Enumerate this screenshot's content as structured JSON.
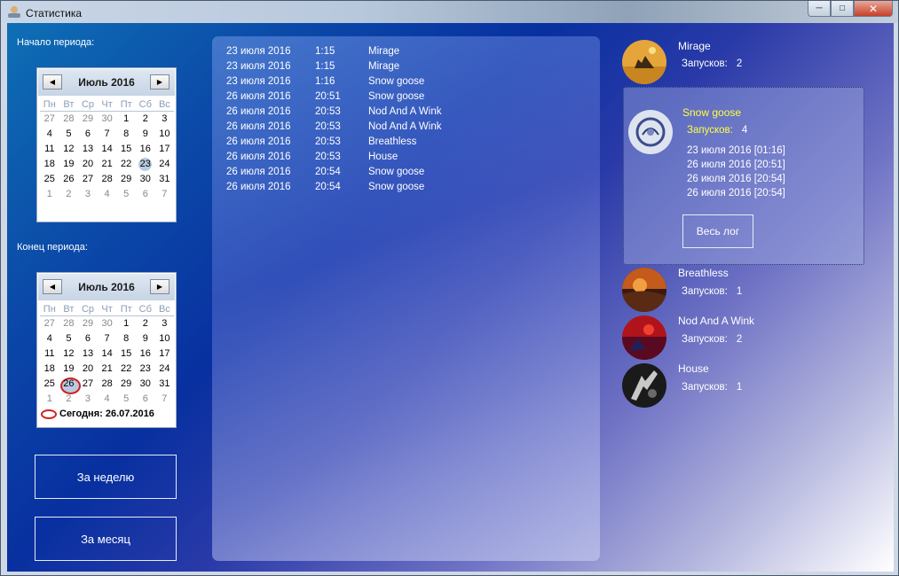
{
  "window": {
    "title": "Статистика"
  },
  "start": {
    "label": "Начало периода:",
    "calendar": {
      "title": "Июль 2016",
      "dow": [
        "Пн",
        "Вт",
        "Ср",
        "Чт",
        "Пт",
        "Сб",
        "Вс"
      ],
      "days": [
        "27",
        "28",
        "29",
        "30",
        "1",
        "2",
        "3",
        "4",
        "5",
        "6",
        "7",
        "8",
        "9",
        "10",
        "11",
        "12",
        "13",
        "14",
        "15",
        "16",
        "17",
        "18",
        "19",
        "20",
        "21",
        "22",
        "23",
        "24",
        "25",
        "26",
        "27",
        "28",
        "29",
        "30",
        "31",
        "1",
        "2",
        "3",
        "4",
        "5",
        "6",
        "7"
      ],
      "selected": "23"
    }
  },
  "end": {
    "label": "Конец периода:",
    "calendar": {
      "title": "Июль 2016",
      "dow": [
        "Пн",
        "Вт",
        "Ср",
        "Чт",
        "Пт",
        "Сб",
        "Вс"
      ],
      "days": [
        "27",
        "28",
        "29",
        "30",
        "1",
        "2",
        "3",
        "4",
        "5",
        "6",
        "7",
        "8",
        "9",
        "10",
        "11",
        "12",
        "13",
        "14",
        "15",
        "16",
        "17",
        "18",
        "19",
        "20",
        "21",
        "22",
        "23",
        "24",
        "25",
        "26",
        "27",
        "28",
        "29",
        "30",
        "31",
        "1",
        "2",
        "3",
        "4",
        "5",
        "6",
        "7"
      ],
      "selected": "26",
      "today_text": "Сегодня: 26.07.2016"
    }
  },
  "buttons": {
    "week": "За неделю",
    "month": "За месяц"
  },
  "log": [
    {
      "date": "23 июля 2016",
      "time": "1:15",
      "name": "Mirage"
    },
    {
      "date": "23 июля 2016",
      "time": "1:15",
      "name": "Mirage"
    },
    {
      "date": "23 июля 2016",
      "time": "1:16",
      "name": "Snow goose"
    },
    {
      "date": "26 июля 2016",
      "time": "20:51",
      "name": "Snow goose"
    },
    {
      "date": "26 июля 2016",
      "time": "20:53",
      "name": "Nod And A Wink"
    },
    {
      "date": "26 июля 2016",
      "time": "20:53",
      "name": "Nod And A Wink"
    },
    {
      "date": "26 июля 2016",
      "time": "20:53",
      "name": "Breathless"
    },
    {
      "date": "26 июля 2016",
      "time": "20:53",
      "name": "House"
    },
    {
      "date": "26 июля 2016",
      "time": "20:54",
      "name": "Snow goose"
    },
    {
      "date": "26 июля 2016",
      "time": "20:54",
      "name": "Snow goose"
    }
  ],
  "albums": {
    "runs_label": "Запусков:",
    "mirage": {
      "name": "Mirage",
      "count": "2"
    },
    "snow_goose": {
      "name": "Snow goose",
      "count": "4",
      "history": [
        "23 июля 2016  [01:16]",
        "26 июля 2016  [20:51]",
        "26 июля 2016  [20:54]",
        "26 июля 2016  [20:54]"
      ],
      "full_log": "Весь лог"
    },
    "breathless": {
      "name": "Breathless",
      "count": "1"
    },
    "nod": {
      "name": "Nod And A Wink",
      "count": "2"
    },
    "house": {
      "name": "House",
      "count": "1"
    }
  }
}
